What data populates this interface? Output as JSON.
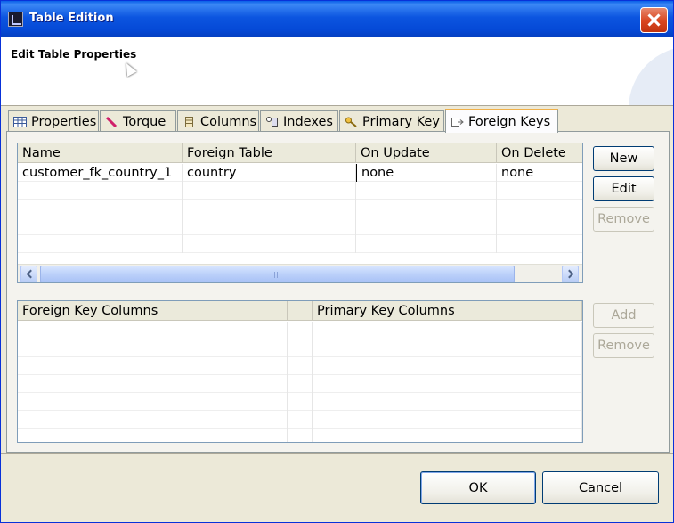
{
  "window": {
    "title": "Table Edition",
    "close_label": "Close"
  },
  "header": {
    "title": "Edit Table Properties"
  },
  "tabs": [
    {
      "label": "Properties",
      "icon": "table-icon"
    },
    {
      "label": "Torque",
      "icon": "pen-icon"
    },
    {
      "label": "Columns",
      "icon": "columns-icon"
    },
    {
      "label": "Indexes",
      "icon": "indexes-icon"
    },
    {
      "label": "Primary Key",
      "icon": "key-icon"
    },
    {
      "label": "Foreign Keys",
      "icon": "foreign-key-icon",
      "active": true
    }
  ],
  "foreign_keys_table": {
    "columns": [
      "Name",
      "Foreign Table",
      "On Update",
      "On Delete"
    ],
    "rows": [
      [
        "customer_fk_country_1",
        "country",
        "none",
        "none"
      ]
    ]
  },
  "fk_buttons": {
    "new": "New",
    "edit": "Edit",
    "remove": "Remove"
  },
  "key_columns_table": {
    "columns": [
      "Foreign Key Columns",
      "",
      "Primary Key Columns"
    ]
  },
  "column_buttons": {
    "add": "Add",
    "remove": "Remove"
  },
  "footer": {
    "ok": "OK",
    "cancel": "Cancel"
  },
  "colors": {
    "titlebar": "#0549d6",
    "active_tab_accent": "#f0b04a",
    "dialog_bg": "#ece9d8"
  }
}
